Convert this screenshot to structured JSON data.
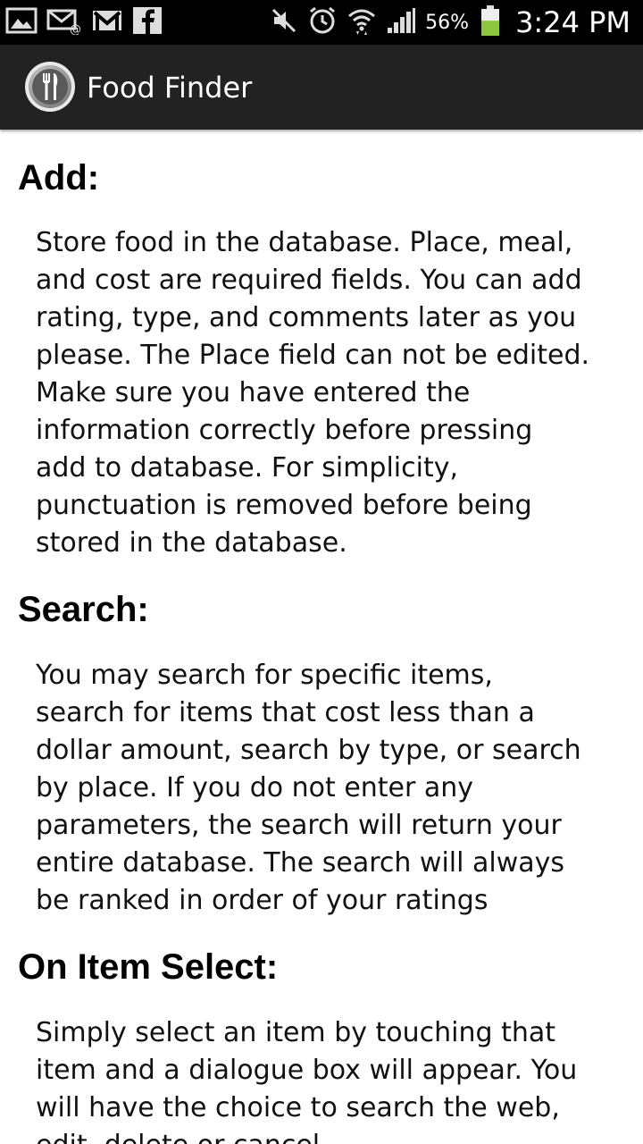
{
  "status_bar": {
    "icons_left": [
      "gallery-icon",
      "email-icon",
      "gmail-icon",
      "facebook-icon"
    ],
    "icons_right": [
      "mute-icon",
      "alarm-icon",
      "wifi-icon",
      "signal-icon",
      "battery-icon"
    ],
    "battery_percent": "56%",
    "battery_level": 0.56,
    "time": "3:24 PM"
  },
  "action_bar": {
    "title": "Food Finder",
    "logo_icon": "fork-knife-icon",
    "background": "#222222"
  },
  "sections": [
    {
      "heading": "Add:",
      "lines": [
        "Store food in the database. Place, meal,",
        "and cost are required fields. You can add",
        "rating, type, and comments later as you",
        "please. The Place field can not be edited.",
        "Make sure you have entered the",
        "information correctly before pressing",
        "add to database. For simplicity,",
        "punctuation is removed before being",
        "stored in the database."
      ]
    },
    {
      "heading": "Search:",
      "lines": [
        "You may search for specific items,",
        "search for items that cost less than a",
        "dollar amount, search by type, or search",
        "by place. If you do not enter any",
        "parameters, the search will return your",
        "entire database. The search will always",
        "be ranked in order of your ratings"
      ]
    },
    {
      "heading": "On Item Select:",
      "lines": [
        "Simply select an item by touching that",
        "item and a dialogue box will appear. You",
        "will have the choice to search the web,",
        "edit, delete or cancel."
      ]
    }
  ]
}
